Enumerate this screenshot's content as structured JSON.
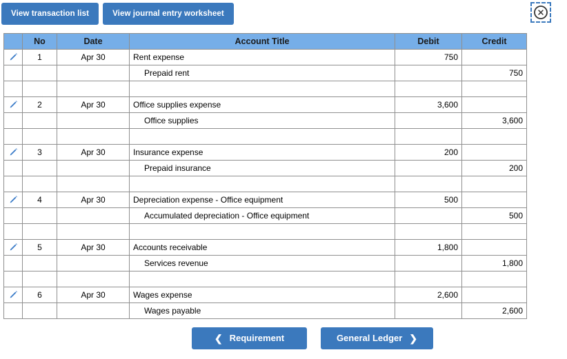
{
  "toolbar": {
    "view_transaction_list": "View transaction list",
    "view_journal_entry_worksheet": "View journal entry worksheet"
  },
  "close_button": {
    "icon": "close-circle-icon",
    "label": "Close"
  },
  "table": {
    "headers": {
      "no": "No",
      "date": "Date",
      "account_title": "Account Title",
      "debit": "Debit",
      "credit": "Credit"
    },
    "edit_icon": "pencil-icon",
    "entries": [
      {
        "no": "1",
        "date": "Apr 30",
        "debit_line": {
          "account": "Rent expense",
          "debit": "750",
          "credit": ""
        },
        "credit_line": {
          "account": "Prepaid rent",
          "debit": "",
          "credit": "750"
        }
      },
      {
        "no": "2",
        "date": "Apr 30",
        "debit_line": {
          "account": "Office supplies expense",
          "debit": "3,600",
          "credit": ""
        },
        "credit_line": {
          "account": "Office supplies",
          "debit": "",
          "credit": "3,600"
        }
      },
      {
        "no": "3",
        "date": "Apr 30",
        "debit_line": {
          "account": "Insurance expense",
          "debit": "200",
          "credit": ""
        },
        "credit_line": {
          "account": "Prepaid insurance",
          "debit": "",
          "credit": "200"
        }
      },
      {
        "no": "4",
        "date": "Apr 30",
        "debit_line": {
          "account": "Depreciation expense - Office equipment",
          "debit": "500",
          "credit": ""
        },
        "credit_line": {
          "account": "Accumulated depreciation - Office equipment",
          "debit": "",
          "credit": "500"
        }
      },
      {
        "no": "5",
        "date": "Apr 30",
        "debit_line": {
          "account": "Accounts receivable",
          "debit": "1,800",
          "credit": ""
        },
        "credit_line": {
          "account": "Services revenue",
          "debit": "",
          "credit": "1,800"
        }
      },
      {
        "no": "6",
        "date": "Apr 30",
        "debit_line": {
          "account": "Wages expense",
          "debit": "2,600",
          "credit": ""
        },
        "credit_line": {
          "account": "Wages payable",
          "debit": "",
          "credit": "2,600"
        }
      }
    ]
  },
  "bottom_nav": {
    "previous_label": "Requirement",
    "previous_chevron": "❮",
    "next_label": "General Ledger",
    "next_chevron": "❯"
  },
  "colors": {
    "button_blue": "#3b79bd",
    "header_blue": "#76aee8",
    "border_gray": "#8f8f8f",
    "pencil_blue": "#3a7bc8"
  }
}
